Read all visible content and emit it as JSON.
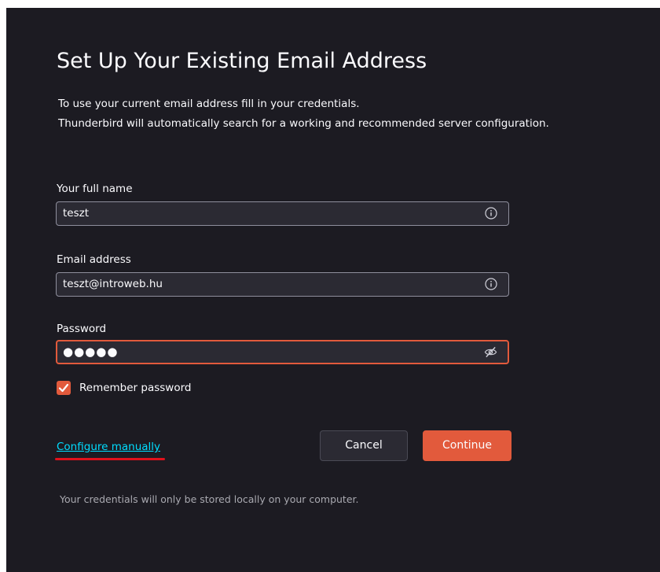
{
  "dialog": {
    "title": "Set Up Your Existing Email Address",
    "description_line1": "To use your current email address fill in your credentials.",
    "description_line2": "Thunderbird will automatically search for a working and recommended server configuration."
  },
  "form": {
    "full_name": {
      "label": "Your full name",
      "value": "teszt"
    },
    "email": {
      "label": "Email address",
      "value": "teszt@introweb.hu"
    },
    "password": {
      "label": "Password",
      "value": "●●●●●"
    },
    "remember_password": {
      "label": "Remember password",
      "checked": true
    }
  },
  "actions": {
    "configure_manually": "Configure manually",
    "cancel": "Cancel",
    "continue": "Continue"
  },
  "footer": {
    "note": "Your credentials will only be stored locally on your computer."
  },
  "colors": {
    "background": "#1c1b22",
    "input_background": "#2b2a33",
    "accent": "#e25a3c",
    "link": "#00ddff",
    "annotation_underline": "#e0111b"
  },
  "icons": {
    "name_field": "info-icon",
    "email_field": "info-icon",
    "password_field": "eye-slash-icon",
    "checkbox": "checkmark-icon"
  }
}
